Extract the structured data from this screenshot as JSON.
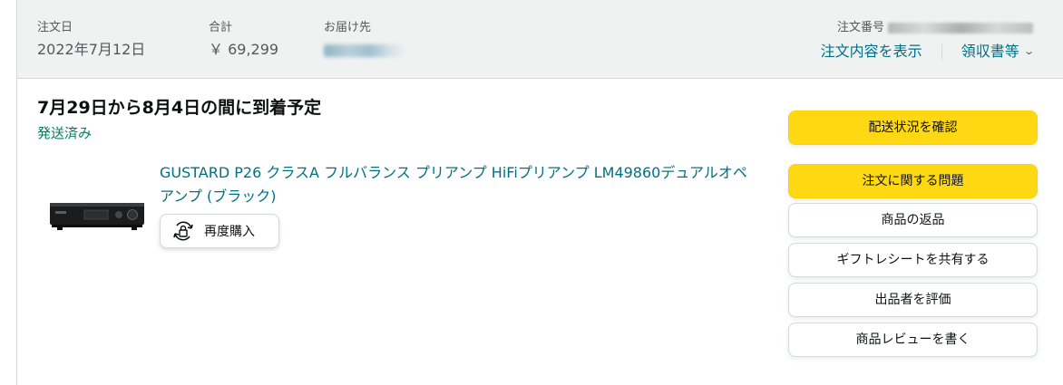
{
  "header": {
    "order_date_label": "注文日",
    "order_date_value": "2022年7月12日",
    "total_label": "合計",
    "total_value": "￥ 69,299",
    "ship_to_label": "お届け先",
    "order_number_label": "注文番号",
    "view_details_link": "注文内容を表示",
    "receipt_link": "領収書等"
  },
  "shipment": {
    "delivery_title": "7月29日から8月4日の間に到着予定",
    "status": "発送済み"
  },
  "product": {
    "title": "GUSTARD P26 クラスA フルバランス プリアンプ HiFiプリアンプ LM49860デュアルオペアンプ (ブラック)",
    "rebuy_label": "再度購入"
  },
  "actions": {
    "track_package": "配送状況を確認",
    "problem_with_order": "注文に関する問題",
    "return_item": "商品の返品",
    "share_gift_receipt": "ギフトレシートを共有する",
    "seller_feedback": "出品者を評価",
    "write_review": "商品レビューを書く"
  },
  "colors": {
    "link": "#007185",
    "status_green": "#067d62",
    "primary_button": "#ffd814",
    "header_bg": "#f0f2f2"
  },
  "icons": [
    "rebuy-icon",
    "chevron-down-icon"
  ]
}
